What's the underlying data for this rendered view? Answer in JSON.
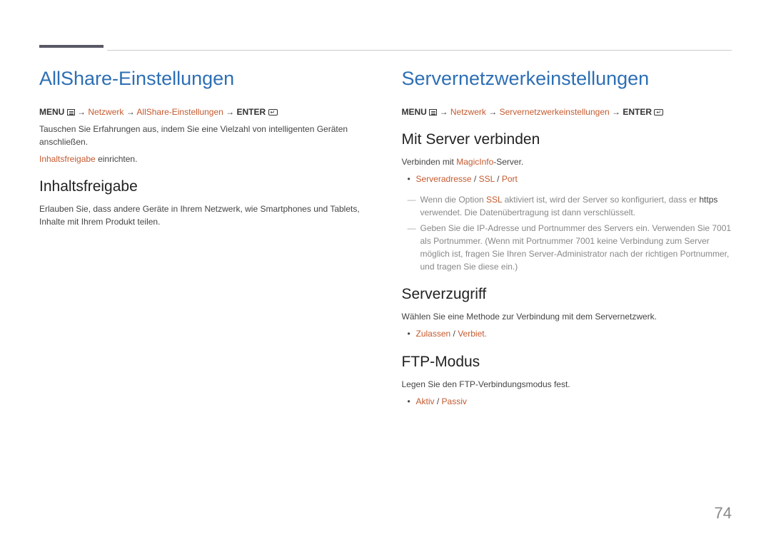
{
  "pageNumber": "74",
  "left": {
    "heading": "AllShare-Einstellungen",
    "breadcrumb": {
      "menu": "MENU",
      "arrow": "→",
      "netzwerk": "Netzwerk",
      "allshare": "AllShare-Einstellungen",
      "enter": "ENTER"
    },
    "intro": "Tauschen Sie Erfahrungen aus, indem Sie eine Vielzahl von intelligenten Geräten anschließen.",
    "introLink": "Inhaltsfreigabe",
    "introAfter": " einrichten.",
    "section1Title": "Inhaltsfreigabe",
    "section1Body": "Erlauben Sie, dass andere Geräte in Ihrem Netzwerk, wie Smartphones und Tablets, Inhalte mit Ihrem Produkt teilen."
  },
  "right": {
    "heading": "Servernetzwerkeinstellungen",
    "breadcrumb": {
      "menu": "MENU",
      "arrow": "→",
      "netzwerk": "Netzwerk",
      "server": "Servernetzwerkeinstellungen",
      "enter": "ENTER"
    },
    "section1Title": "Mit Server verbinden",
    "s1_pre": "Verbinden mit ",
    "s1_link": "MagicInfo",
    "s1_post": "-Server.",
    "s1_bullet_a": "Serveradresse",
    "s1_bullet_sep": " / ",
    "s1_bullet_b": "SSL",
    "s1_bullet_c": "Port",
    "s1_dash1_pre": "Wenn die Option ",
    "s1_dash1_ssl": "SSL",
    "s1_dash1_mid": " aktiviert ist, wird der Server so konfiguriert, dass er ",
    "s1_dash1_https": "https",
    "s1_dash1_post": " verwendet. Die Datenübertragung ist dann verschlüsselt.",
    "s1_dash2": "Geben Sie die IP-Adresse und Portnummer des Servers ein. Verwenden Sie 7001 als Portnummer. (Wenn mit Portnummer 7001 keine Verbindung zum Server möglich ist, fragen Sie Ihren Server-Administrator nach der richtigen Portnummer, und tragen Sie diese ein.)",
    "section2Title": "Serverzugriff",
    "s2_body": "Wählen Sie eine Methode zur Verbindung mit dem Servernetzwerk.",
    "s2_opt_a": "Zulassen",
    "s2_opt_sep": " / ",
    "s2_opt_b": "Verbiet.",
    "section3Title": "FTP-Modus",
    "s3_body": "Legen Sie den FTP-Verbindungsmodus fest.",
    "s3_opt_a": "Aktiv",
    "s3_opt_sep": " / ",
    "s3_opt_b": "Passiv"
  }
}
